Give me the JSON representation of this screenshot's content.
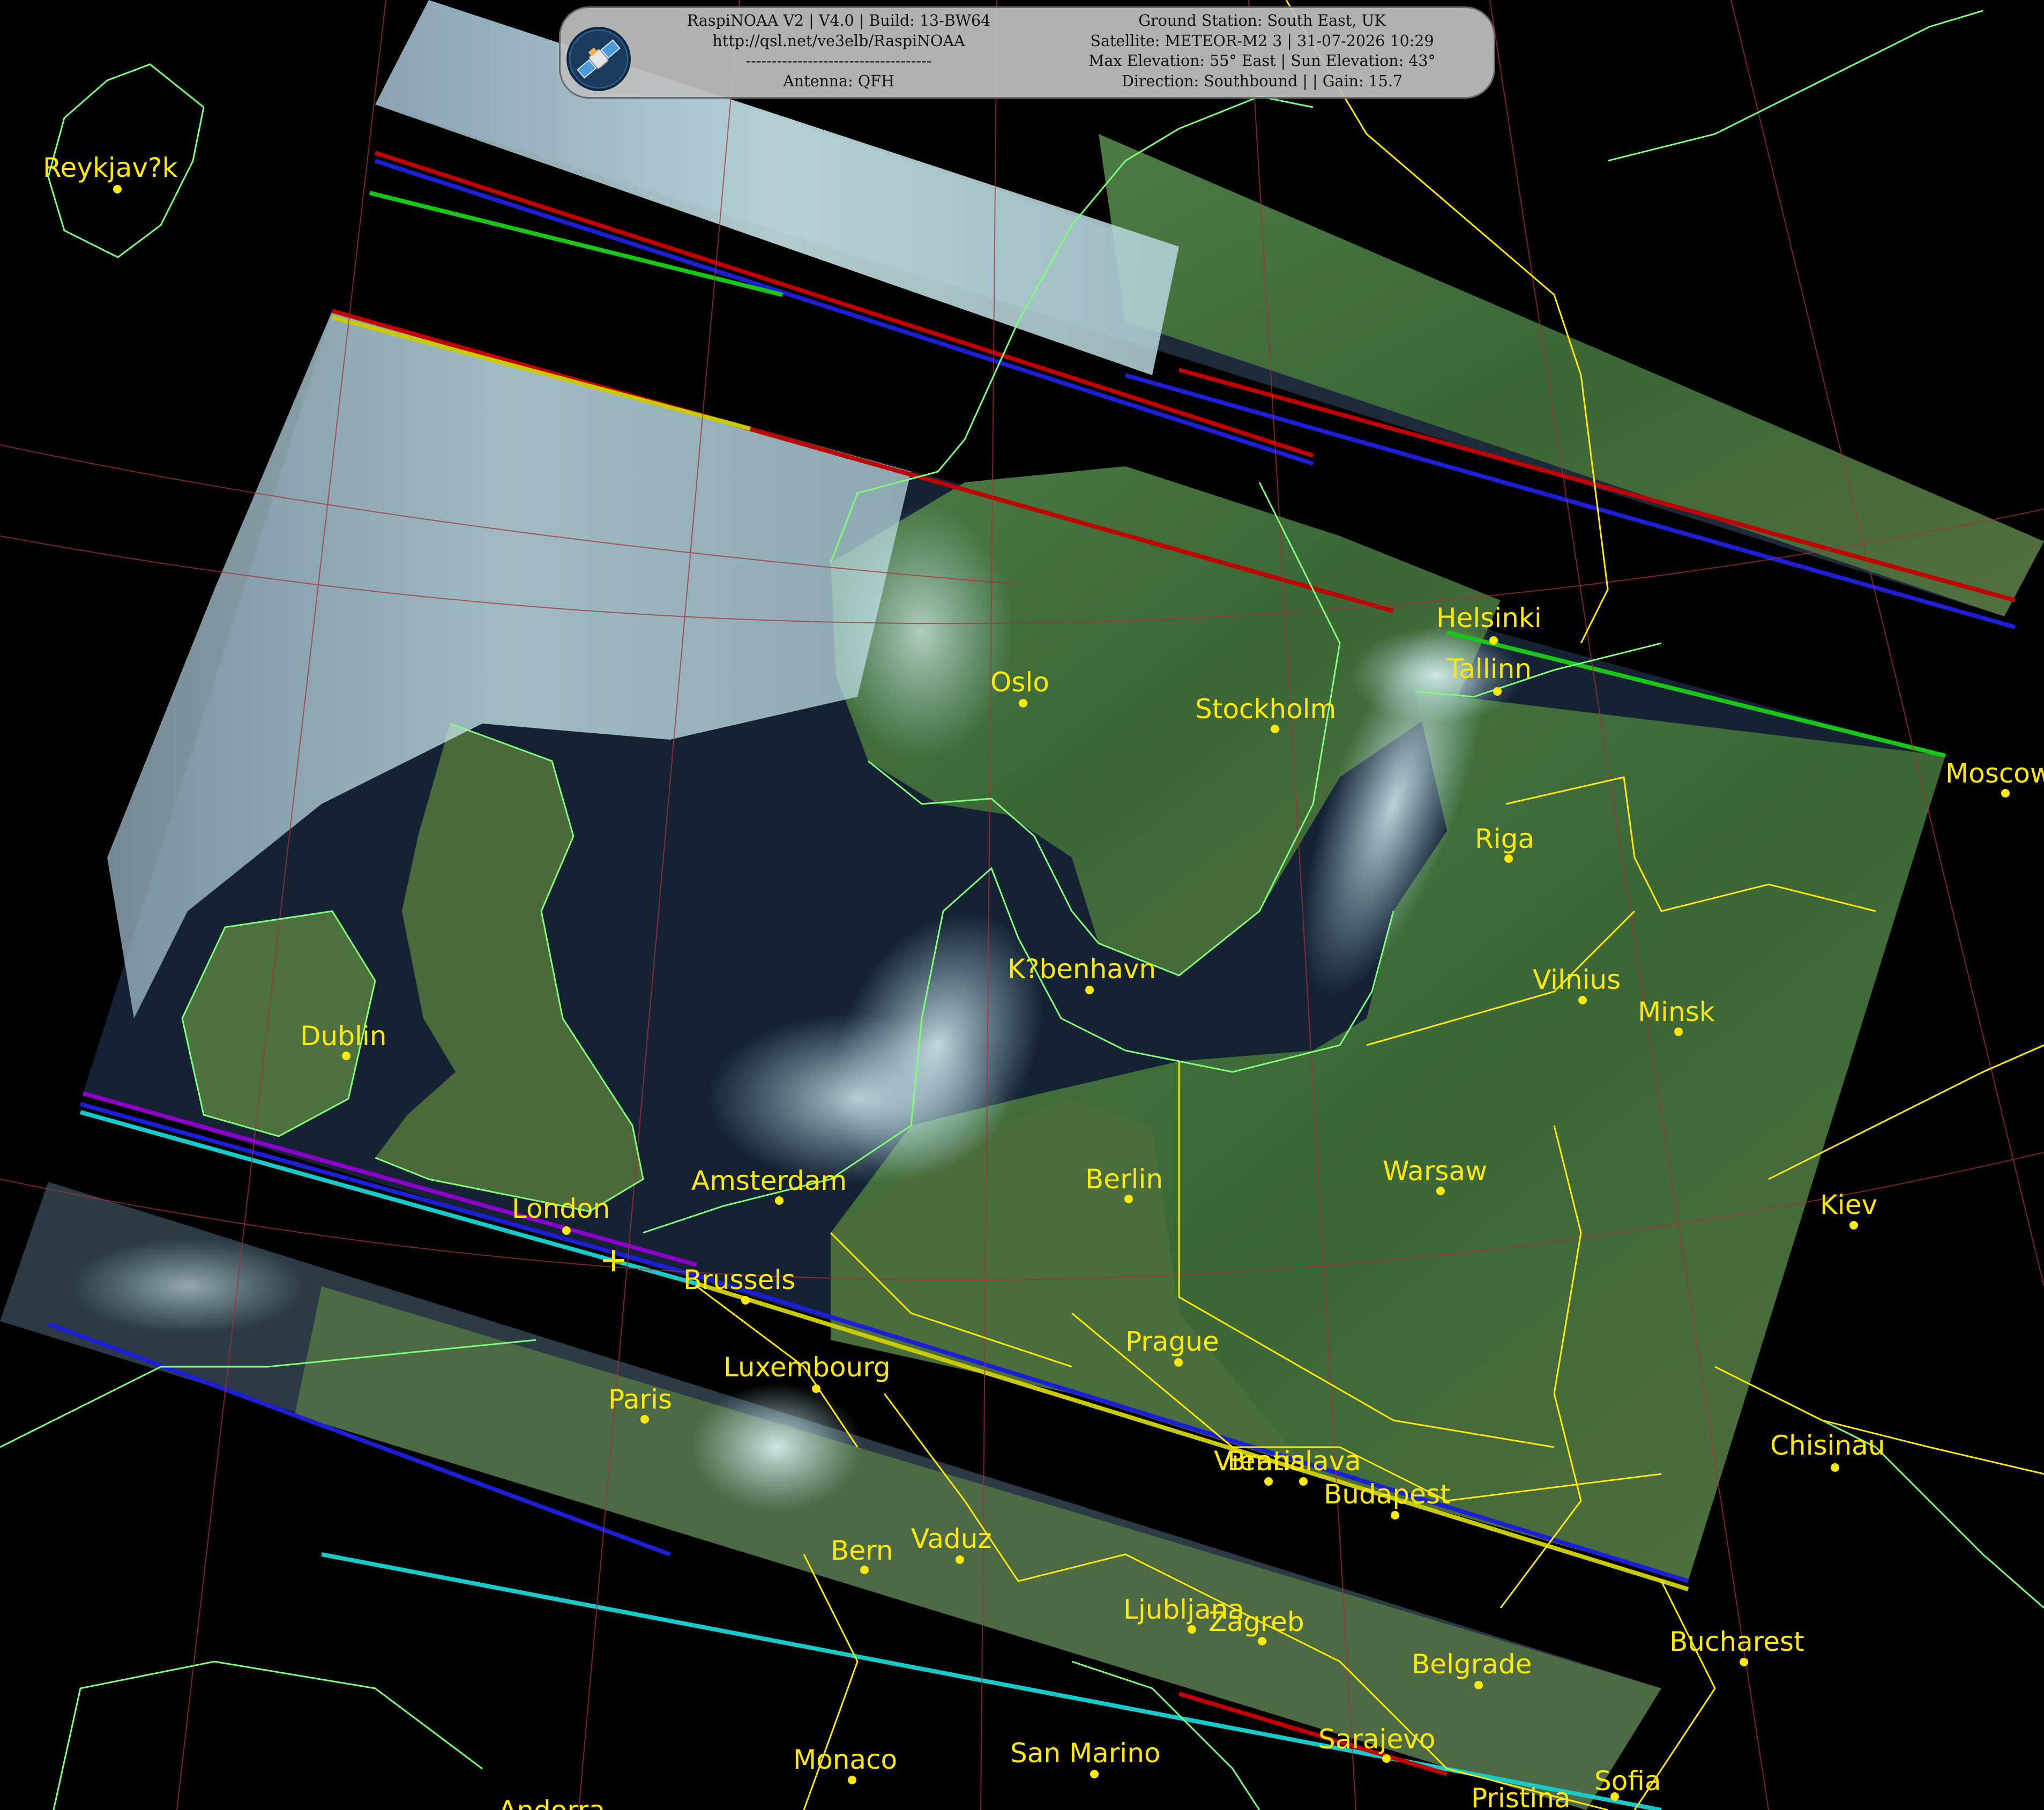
{
  "header": {
    "left_lines": [
      "RaspiNOAA V2 | V4.0 | Build: 13-BW64",
      "http://qsl.net/ve3elb/RaspiNOAA",
      "------------------------------------",
      "Antenna: QFH"
    ],
    "right_lines": [
      "Ground Station: South East, UK",
      "Satellite: METEOR-M2 3 | 31-07-2026 10:29",
      "Max Elevation: 55° East | Sun Elevation: 43°",
      "Direction: Southbound | | Gain: 15.7"
    ],
    "logo": "satellite-logo-icon"
  },
  "colors": {
    "city": "#ffe900",
    "borders": "#ffe900",
    "coastline": "#7dff7a",
    "graticule": "#a8303a",
    "ocean": "#101a2a",
    "land": "#3f6a3a",
    "cloud": "#b8ecf0"
  },
  "cities": [
    {
      "name": "Reykjav?k"
    },
    {
      "name": "Helsinki"
    },
    {
      "name": "Tallinn"
    },
    {
      "name": "Oslo"
    },
    {
      "name": "Stockholm"
    },
    {
      "name": "Moscow"
    },
    {
      "name": "Riga"
    },
    {
      "name": "K?benhavn"
    },
    {
      "name": "Vilnius"
    },
    {
      "name": "Minsk"
    },
    {
      "name": "Dublin"
    },
    {
      "name": "Amsterdam"
    },
    {
      "name": "Berlin"
    },
    {
      "name": "Warsaw"
    },
    {
      "name": "London"
    },
    {
      "name": "Brussels"
    },
    {
      "name": "Kiev"
    },
    {
      "name": "Prague"
    },
    {
      "name": "Luxembourg"
    },
    {
      "name": "Paris"
    },
    {
      "name": "Vienna"
    },
    {
      "name": "Bratislava"
    },
    {
      "name": "Chisinau"
    },
    {
      "name": "Budapest"
    },
    {
      "name": "Bern"
    },
    {
      "name": "Vaduz"
    },
    {
      "name": "Ljubljana"
    },
    {
      "name": "Zagreb"
    },
    {
      "name": "Bucharest"
    },
    {
      "name": "Belgrade"
    },
    {
      "name": "Sarajevo"
    },
    {
      "name": "Monaco"
    },
    {
      "name": "San Marino"
    },
    {
      "name": "Sofia"
    },
    {
      "name": "Pristina"
    },
    {
      "name": "Andorra"
    }
  ],
  "ground_station_marker": "ground-station-cross-icon"
}
